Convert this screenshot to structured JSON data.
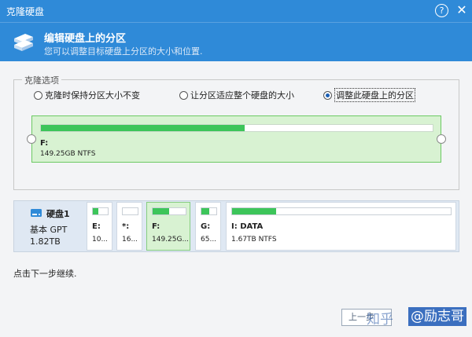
{
  "window": {
    "title": "克隆硬盘",
    "help_glyph": "?",
    "close_glyph": "✕"
  },
  "header": {
    "title": "编辑硬盘上的分区",
    "subtitle": "您可以调整目标硬盘上分区的大小和位置."
  },
  "clone_options": {
    "legend": "克隆选项",
    "options": [
      {
        "label": "克隆时保持分区大小不变",
        "selected": false
      },
      {
        "label": "让分区适应整个硬盘的大小",
        "selected": false
      },
      {
        "label": "调整此硬盘上的分区",
        "selected": true
      }
    ]
  },
  "partition_editor": {
    "name": "F:",
    "info": "149.25GB NTFS",
    "usage_fraction": 0.52
  },
  "disk": {
    "name": "硬盘1",
    "type": "基本 GPT",
    "size": "1.82TB",
    "partitions": [
      {
        "label": "E:",
        "size": "10...",
        "usage_fraction": 0.35,
        "selected": false
      },
      {
        "label": "*:",
        "size": "16...",
        "usage_fraction": 0.0,
        "selected": false
      },
      {
        "label": "F:",
        "size": "149.25G...",
        "usage_fraction": 0.5,
        "selected": true
      },
      {
        "label": "G:",
        "size": "65...",
        "usage_fraction": 0.55,
        "selected": false
      },
      {
        "label": "I: DATA",
        "size": "1.67TB NTFS",
        "usage_fraction": 0.2,
        "selected": false
      }
    ]
  },
  "hint": "点击下一步继续.",
  "buttons": {
    "prev": "上一步"
  },
  "watermark": {
    "left": "知乎",
    "right": "@励志哥"
  },
  "colors": {
    "titlebar": "#2f8ad8",
    "usage_green": "#3dc55a",
    "selected_bg": "#d8f2d2"
  }
}
